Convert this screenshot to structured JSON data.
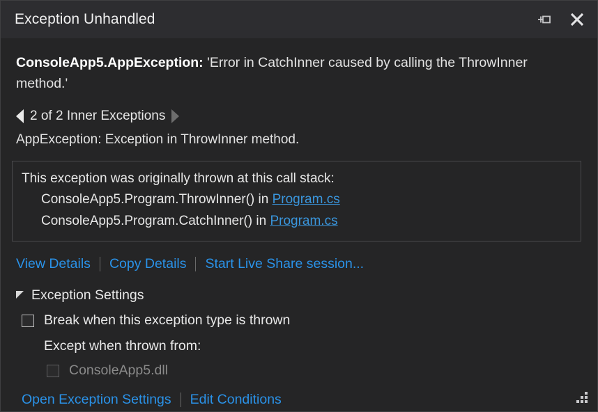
{
  "window": {
    "title": "Exception Unhandled",
    "pin_icon": "pin-icon",
    "close_icon": "close-icon",
    "resize_grip": "resize-grip"
  },
  "exception": {
    "type": "ConsoleApp5.AppException:",
    "message": "'Error in CatchInner caused by calling the ThrowInner method.'"
  },
  "inner_navigation": {
    "prev_arrow": "previous-inner-exception-arrow",
    "next_arrow": "next-inner-exception-arrow",
    "label": "2 of 2 Inner Exceptions",
    "current_index": 2,
    "total": 2,
    "detail": "AppException: Exception in ThrowInner method."
  },
  "call_stack": {
    "title": "This exception was originally thrown at this call stack:",
    "frames": [
      {
        "method": "ConsoleApp5.Program.ThrowInner() in ",
        "link": "Program.cs"
      },
      {
        "method": "ConsoleApp5.Program.CatchInner() in ",
        "link": "Program.cs"
      }
    ]
  },
  "action_links": {
    "view_details": "View Details",
    "copy_details": "Copy Details",
    "live_share": "Start Live Share session..."
  },
  "exception_settings": {
    "header": "Exception Settings",
    "expanded": true,
    "break_when_thrown": {
      "label": "Break when this exception type is thrown",
      "checked": false
    },
    "except_when_label": "Except when thrown from:",
    "modules": [
      {
        "label": "ConsoleApp5.dll",
        "checked": false,
        "disabled": true
      }
    ],
    "links": {
      "open_settings": "Open Exception Settings",
      "edit_conditions": "Edit Conditions"
    }
  },
  "colors": {
    "titlebar_bg": "#2d2d30",
    "body_bg": "#252526",
    "link": "#2a92e8",
    "text": "#e8e8e8",
    "disabled_text": "#8a8a8a",
    "border": "#4a4a4d"
  }
}
